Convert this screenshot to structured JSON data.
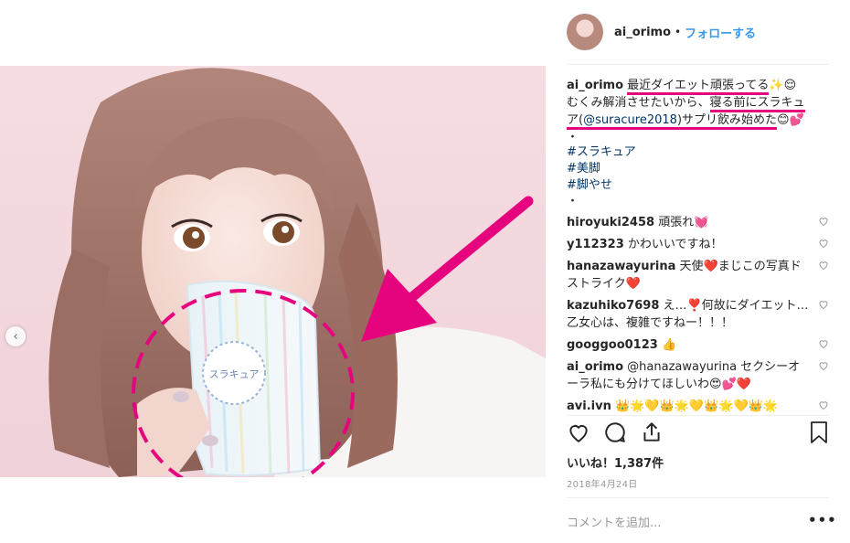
{
  "header": {
    "username": "ai_orimo",
    "dot": "•",
    "follow_label": "フォローする"
  },
  "caption": {
    "username": "ai_orimo",
    "part1": "最近ダイエット頑張ってる",
    "emoji1": "✨😌",
    "line2a": "むくみ解消させたいから、",
    "line2b": "寝る前にスラキュ",
    "line3a": "ア(",
    "mention": "@suracure2018",
    "line3b": ")サプリ飲み始めた",
    "emoji3": "😊💕",
    "dot": "・",
    "hashtags": [
      "#スラキュア",
      "#美脚",
      "#脚やせ"
    ],
    "dot2": "・"
  },
  "comments": [
    {
      "user": "hiroyuki2458",
      "text": "頑張れ💓"
    },
    {
      "user": "y112323",
      "text": "かわいいですね！"
    },
    {
      "user": "hanazawayurina",
      "text": "天使❤️まじこの写真ドストライク❤️"
    },
    {
      "user": "kazuhiko7698",
      "text": "え…❣️何故にダイエット…乙女心は、複雑ですねー！！！"
    },
    {
      "user": "googgoo0123",
      "text": "👍"
    },
    {
      "user": "ai_orimo",
      "text": "@hanazawayurina セクシーオーラ私にも分けてほしいわ😍💕❤️"
    },
    {
      "user": "avi.ivn",
      "text": "👑🌟💛👑🌟💛👑🌟💛👑🌟"
    }
  ],
  "likes": "いいね！1,387件",
  "date": "2018年4月24日",
  "add_comment_placeholder": "コメントを追加...",
  "more_label": "•••",
  "product_label": "スラキュア",
  "icons": {
    "heart": "heart-icon",
    "comment": "comment-icon",
    "share": "share-icon",
    "bookmark": "bookmark-icon",
    "prev": "chevron-left-icon"
  },
  "colors": {
    "accent": "#3897f0",
    "highlight": "#e5047e",
    "link": "#003569"
  }
}
